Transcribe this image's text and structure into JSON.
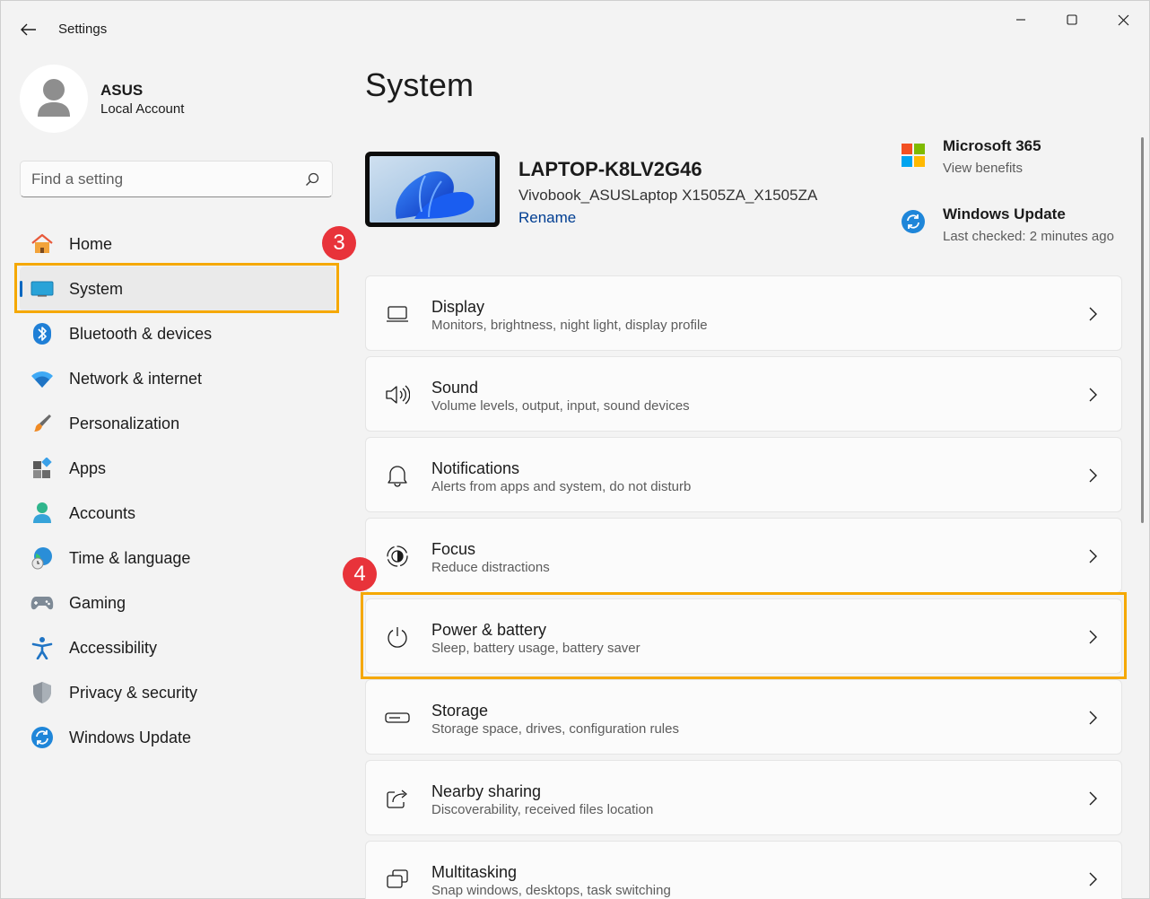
{
  "window": {
    "app_title": "Settings"
  },
  "profile": {
    "name": "ASUS",
    "account_type": "Local Account"
  },
  "search": {
    "placeholder": "Find a setting"
  },
  "sidebar": {
    "items": [
      {
        "label": "Home",
        "icon": "home-icon"
      },
      {
        "label": "System",
        "icon": "system-display-icon",
        "active": true
      },
      {
        "label": "Bluetooth & devices",
        "icon": "bluetooth-icon"
      },
      {
        "label": "Network & internet",
        "icon": "wifi-icon"
      },
      {
        "label": "Personalization",
        "icon": "paintbrush-icon"
      },
      {
        "label": "Apps",
        "icon": "apps-icon"
      },
      {
        "label": "Accounts",
        "icon": "accounts-icon"
      },
      {
        "label": "Time & language",
        "icon": "globe-clock-icon"
      },
      {
        "label": "Gaming",
        "icon": "gamepad-icon"
      },
      {
        "label": "Accessibility",
        "icon": "accessibility-icon"
      },
      {
        "label": "Privacy & security",
        "icon": "shield-icon"
      },
      {
        "label": "Windows Update",
        "icon": "windows-update-icon"
      }
    ]
  },
  "annotations": {
    "step3": "3",
    "step4": "4",
    "highlight_color": "#f5a800",
    "badge_color": "#e8333a"
  },
  "main": {
    "page_title": "System",
    "device": {
      "name": "LAPTOP-K8LV2G46",
      "model": "Vivobook_ASUSLaptop X1505ZA_X1505ZA",
      "rename_label": "Rename"
    },
    "promos": [
      {
        "title": "Microsoft 365",
        "subtitle": "View benefits",
        "icon": "microsoft-logo-icon"
      },
      {
        "title": "Windows Update",
        "subtitle": "Last checked: 2 minutes ago",
        "icon": "windows-update-icon"
      }
    ],
    "cards": [
      {
        "title": "Display",
        "subtitle": "Monitors, brightness, night light, display profile",
        "icon": "laptop-icon"
      },
      {
        "title": "Sound",
        "subtitle": "Volume levels, output, input, sound devices",
        "icon": "speaker-icon"
      },
      {
        "title": "Notifications",
        "subtitle": "Alerts from apps and system, do not disturb",
        "icon": "bell-icon"
      },
      {
        "title": "Focus",
        "subtitle": "Reduce distractions",
        "icon": "focus-icon"
      },
      {
        "title": "Power & battery",
        "subtitle": "Sleep, battery usage, battery saver",
        "icon": "power-icon"
      },
      {
        "title": "Storage",
        "subtitle": "Storage space, drives, configuration rules",
        "icon": "storage-drive-icon"
      },
      {
        "title": "Nearby sharing",
        "subtitle": "Discoverability, received files location",
        "icon": "share-icon"
      },
      {
        "title": "Multitasking",
        "subtitle": "Snap windows, desktops, task switching",
        "icon": "multitasking-icon"
      }
    ]
  },
  "colors": {
    "accent": "#0067c0",
    "link": "#003e92",
    "background": "#f3f3f3",
    "card": "#fbfbfb"
  }
}
